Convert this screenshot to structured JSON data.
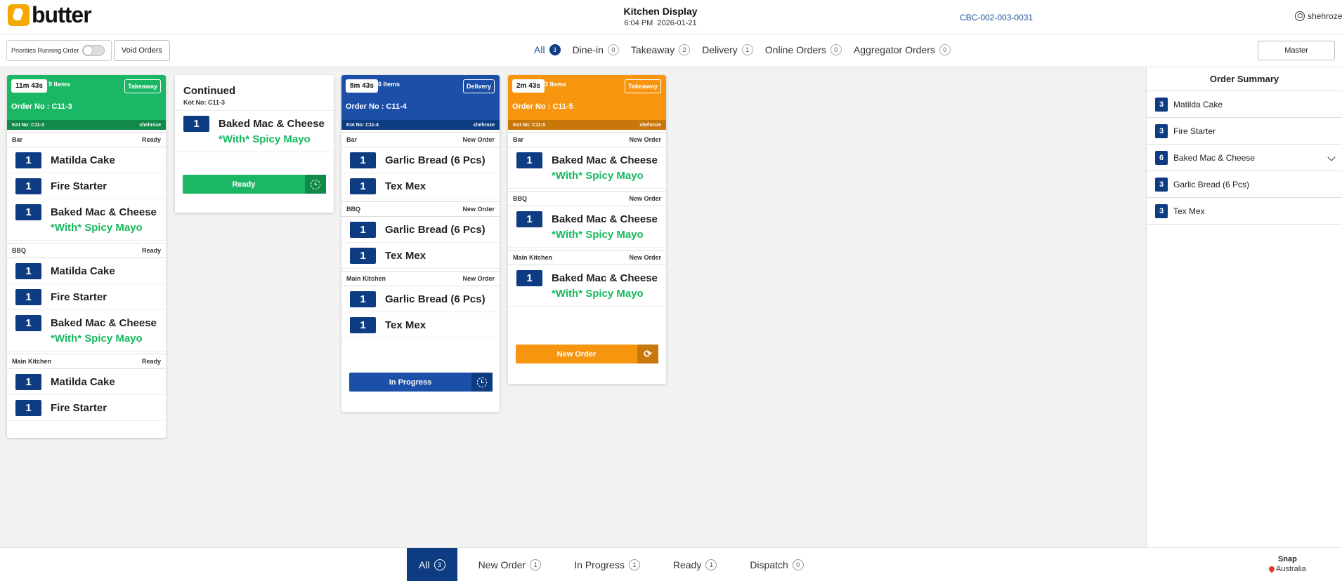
{
  "header": {
    "brand": "butter",
    "title": "Kitchen Display",
    "time": "6:04 PM",
    "date": "2026-01-21",
    "device_id": "CBC-002-003-0031",
    "user": "shehroze"
  },
  "filters": {
    "priority_label": "Priorities Running Order",
    "void_orders_label": "Void Orders",
    "master_label": "Master",
    "tabs": [
      {
        "label": "All",
        "count": "3"
      },
      {
        "label": "Dine-in",
        "count": "0"
      },
      {
        "label": "Takeaway",
        "count": "2"
      },
      {
        "label": "Delivery",
        "count": "1"
      },
      {
        "label": "Online Orders",
        "count": "0"
      },
      {
        "label": "Aggregator Orders",
        "count": "0"
      }
    ]
  },
  "colors": {
    "green": "#1ab764",
    "green_dark": "#0f8a48",
    "blue": "#1c4fa8",
    "blue_dark": "#0d3c82",
    "orange": "#f7950e",
    "orange_dark": "#c8780a",
    "mod_green": "#18b95f"
  },
  "orders": [
    {
      "timer": "11m 43s",
      "items_count": "9 Items",
      "type": "Takeaway",
      "order_no": "Order No : C11-3",
      "kot": "Kot No: C11-3",
      "staff": "shehroze",
      "sections": [
        {
          "name": "Bar",
          "status": "Ready",
          "items": [
            {
              "qty": "1",
              "name": "Matilda Cake"
            },
            {
              "qty": "1",
              "name": "Fire Starter"
            },
            {
              "qty": "1",
              "name": "Baked Mac & Cheese",
              "mod": "*With* Spicy Mayo"
            }
          ]
        },
        {
          "name": "BBQ",
          "status": "Ready",
          "items": [
            {
              "qty": "1",
              "name": "Matilda Cake"
            },
            {
              "qty": "1",
              "name": "Fire Starter"
            },
            {
              "qty": "1",
              "name": "Baked Mac & Cheese",
              "mod": "*With* Spicy Mayo"
            }
          ]
        },
        {
          "name": "Main Kitchen",
          "status": "Ready",
          "items": [
            {
              "qty": "1",
              "name": "Matilda Cake"
            },
            {
              "qty": "1",
              "name": "Fire Starter"
            }
          ]
        }
      ]
    },
    {
      "continued_label": "Continued",
      "kot": "Kot No: C11-3",
      "items": [
        {
          "qty": "1",
          "name": "Baked Mac & Cheese",
          "mod": "*With* Spicy Mayo"
        }
      ],
      "action": "Ready"
    },
    {
      "timer": "8m 43s",
      "items_count": "6 Items",
      "type": "Delivery",
      "order_no": "Order No : C11-4",
      "kot": "Kot No: C11-4",
      "staff": "shehroze",
      "sections": [
        {
          "name": "Bar",
          "status": "New Order",
          "items": [
            {
              "qty": "1",
              "name": "Garlic Bread (6 Pcs)"
            },
            {
              "qty": "1",
              "name": "Tex Mex"
            }
          ]
        },
        {
          "name": "BBQ",
          "status": "New Order",
          "items": [
            {
              "qty": "1",
              "name": "Garlic Bread (6 Pcs)"
            },
            {
              "qty": "1",
              "name": "Tex Mex"
            }
          ]
        },
        {
          "name": "Main Kitchen",
          "status": "New Order",
          "items": [
            {
              "qty": "1",
              "name": "Garlic Bread (6 Pcs)"
            },
            {
              "qty": "1",
              "name": "Tex Mex"
            }
          ]
        }
      ],
      "action": "In Progress"
    },
    {
      "timer": "2m 43s",
      "items_count": "3 Items",
      "type": "Takeaway",
      "order_no": "Order No : C11-5",
      "kot": "Kot No: C11-5",
      "staff": "shehroze",
      "sections": [
        {
          "name": "Bar",
          "status": "New Order",
          "items": [
            {
              "qty": "1",
              "name": "Baked Mac & Cheese",
              "mod": "*With* Spicy Mayo"
            }
          ]
        },
        {
          "name": "BBQ",
          "status": "New Order",
          "items": [
            {
              "qty": "1",
              "name": "Baked Mac & Cheese",
              "mod": "*With* Spicy Mayo"
            }
          ]
        },
        {
          "name": "Main Kitchen",
          "status": "New Order",
          "items": [
            {
              "qty": "1",
              "name": "Baked Mac & Cheese",
              "mod": "*With* Spicy Mayo"
            }
          ]
        }
      ],
      "action": "New Order"
    }
  ],
  "summary": {
    "title": "Order Summary",
    "rows": [
      {
        "qty": "3",
        "name": "Matilda Cake"
      },
      {
        "qty": "3",
        "name": "Fire Starter"
      },
      {
        "qty": "6",
        "name": "Baked Mac & Cheese"
      },
      {
        "qty": "3",
        "name": "Garlic Bread (6 Pcs)"
      },
      {
        "qty": "3",
        "name": "Tex Mex"
      }
    ]
  },
  "status_tabs": [
    {
      "label": "All",
      "count": "3"
    },
    {
      "label": "New Order",
      "count": "1"
    },
    {
      "label": "In Progress",
      "count": "1"
    },
    {
      "label": "Ready",
      "count": "1"
    },
    {
      "label": "Dispatch",
      "count": "0"
    }
  ],
  "snap": {
    "title": "Snap",
    "location": "Australia"
  }
}
